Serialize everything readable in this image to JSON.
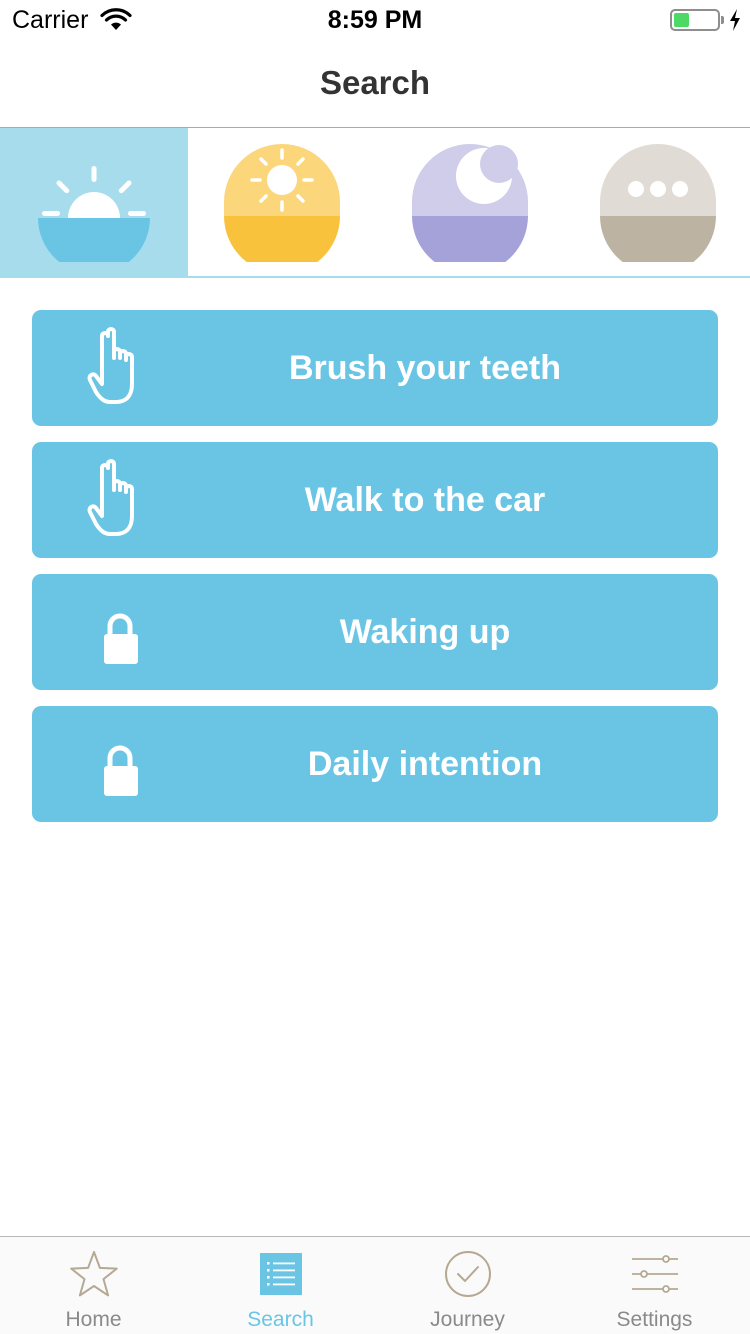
{
  "status_bar": {
    "carrier": "Carrier",
    "time": "8:59 PM",
    "battery_level": 0.35
  },
  "nav": {
    "title": "Search"
  },
  "categories": [
    {
      "name": "sunrise-icon",
      "selected": true
    },
    {
      "name": "sun-icon",
      "selected": false
    },
    {
      "name": "moon-icon",
      "selected": false
    },
    {
      "name": "more-icon",
      "selected": false
    }
  ],
  "activities": [
    {
      "label": "Brush your teeth",
      "icon": "pointing-hand-icon"
    },
    {
      "label": "Walk to the car",
      "icon": "pointing-hand-icon"
    },
    {
      "label": "Waking up",
      "icon": "lock-icon"
    },
    {
      "label": "Daily intention",
      "icon": "lock-icon"
    }
  ],
  "tabs": [
    {
      "label": "Home",
      "icon": "star-icon",
      "active": false
    },
    {
      "label": "Search",
      "icon": "list-icon",
      "active": true
    },
    {
      "label": "Journey",
      "icon": "checkmark-circle-icon",
      "active": false
    },
    {
      "label": "Settings",
      "icon": "sliders-icon",
      "active": false
    }
  ],
  "colors": {
    "accent": "#6ac5e5",
    "selected_tab_bg": "#a6dcec",
    "sun_top": "#fcd67a",
    "sun_bottom": "#f9c23c",
    "moon_top": "#cfcde9",
    "moon_bottom": "#a4a2d8",
    "more_top": "#e0dcd5",
    "more_bottom": "#bcb3a3",
    "tab_inactive": "#b5a993"
  }
}
